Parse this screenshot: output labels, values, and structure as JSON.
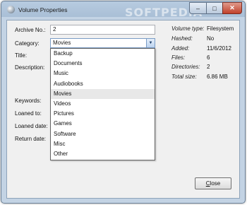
{
  "window": {
    "title": "Volume Properties",
    "watermark": "SOFTPEDIA",
    "minimize_glyph": "–",
    "maximize_glyph": "□",
    "close_glyph": "✕"
  },
  "form": {
    "archive_no_label": "Archive No.:",
    "archive_no_value": "2",
    "category_label": "Category:",
    "category_value": "Movies",
    "title_label": "Title:",
    "description_label": "Description:",
    "keywords_label": "Keywords:",
    "loaned_to_label": "Loaned to:",
    "loaned_date_label": "Loaned date:",
    "return_date_label": "Return date:"
  },
  "category_options": [
    "Backup",
    "Documents",
    "Music",
    "Audiobooks",
    "Movies",
    "Videos",
    "Pictures",
    "Games",
    "Software",
    "Misc",
    "Other"
  ],
  "category_selected_index": 4,
  "info": {
    "volume_type_label": "Volume type:",
    "volume_type_value": "Filesystem",
    "hashed_label": "Hashed:",
    "hashed_value": "No",
    "added_label": "Added:",
    "added_value": "11/6/2012",
    "files_label": "Files:",
    "files_value": "6",
    "directories_label": "Directories:",
    "directories_value": "2",
    "total_size_label": "Total size:",
    "total_size_value": "6.86 MB"
  },
  "buttons": {
    "close_accel": "C",
    "close_rest": "lose"
  }
}
